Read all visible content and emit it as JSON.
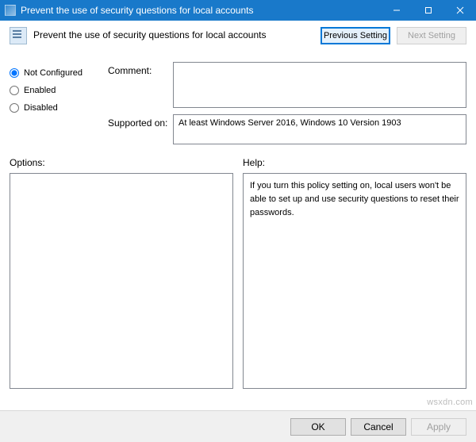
{
  "window": {
    "title": "Prevent the use of security questions for local accounts"
  },
  "header": {
    "title": "Prevent the use of security questions for local accounts",
    "prev_label": "Previous Setting",
    "next_label": "Next Setting"
  },
  "state": {
    "not_configured_label": "Not Configured",
    "enabled_label": "Enabled",
    "disabled_label": "Disabled",
    "selected": "not_configured"
  },
  "fields": {
    "comment_label": "Comment:",
    "comment_value": "",
    "supported_label": "Supported on:",
    "supported_value": "At least Windows Server 2016, Windows 10 Version 1903"
  },
  "sections": {
    "options_label": "Options:",
    "help_label": "Help:",
    "help_text": "If you turn this policy setting on, local users won't be able to set up and use security questions to reset their passwords."
  },
  "buttons": {
    "ok": "OK",
    "cancel": "Cancel",
    "apply": "Apply"
  },
  "watermark": "wsxdn.com"
}
